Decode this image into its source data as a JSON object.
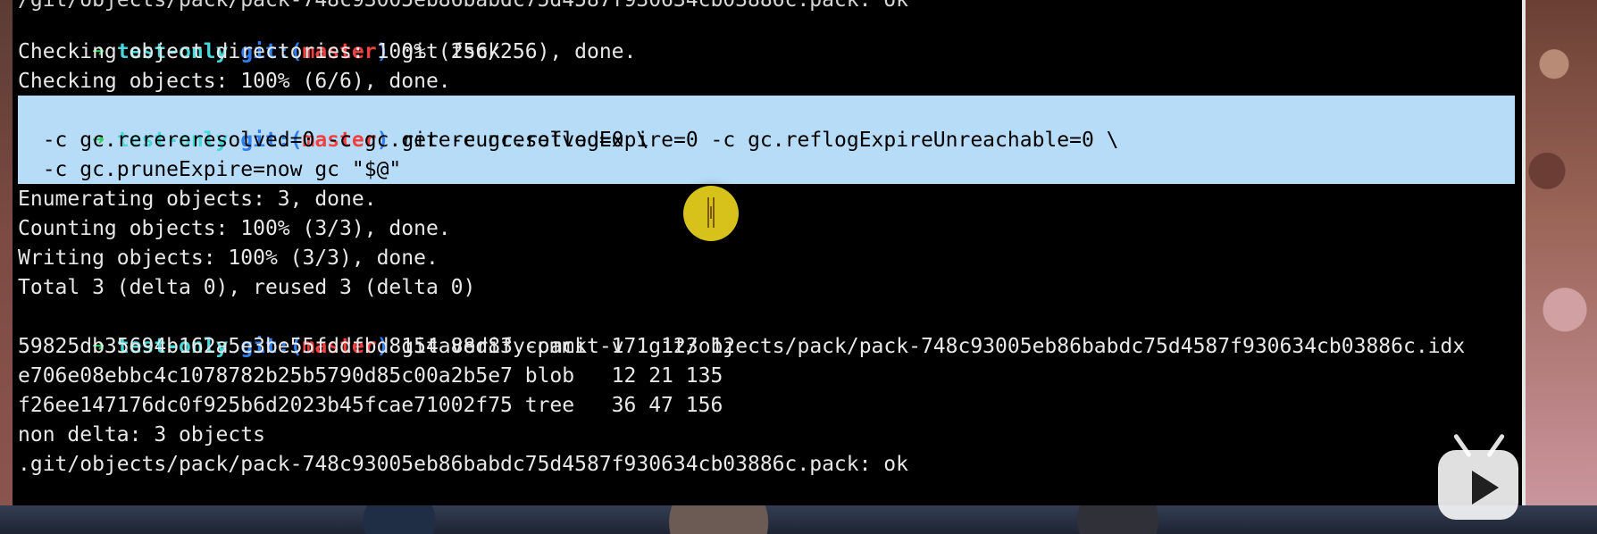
{
  "terminal": {
    "clipped_top": "/git/objects/pack/pack-748c93005eb86babdc75d4587f930634cb03886c.pack: ok",
    "prompt": {
      "arrow": "➜",
      "directory": "test-only",
      "git_label": "git:",
      "open_paren": "(",
      "branch": "master",
      "close_paren": ")"
    },
    "command_1": "git fsck",
    "output_1": [
      "Checking object directories: 100% (256/256), done.",
      "Checking objects: 100% (6/6), done."
    ],
    "command_2_lines": [
      "git -c gc.reflogExpire=0 -c gc.reflogExpireUnreachable=0 \\",
      "  -c gc.rerereresolved=0 -c gc.rerereunresolved=0 \\",
      "  -c gc.pruneExpire=now gc \"$@\""
    ],
    "output_2": [
      "Enumerating objects: 3, done.",
      "Counting objects: 100% (3/3), done.",
      "Writing objects: 100% (3/3), done.",
      "Total 3 (delta 0), reused 3 (delta 0)"
    ],
    "command_3": "git verify-pack -v .git/objects/pack/pack-748c93005eb86babdc75d4587f930634cb03886c.idx",
    "verify_rows": [
      "59825db35694b162a5e3be55fddfbd8154a88d83 commit 171 123 12",
      "e706e08ebbc4c1078782b25b5790d85c00a2b5e7 blob   12 21 135",
      "f26ee147176dc0f925b6d2023b45fcae71002f75 tree   36 47 156"
    ],
    "verify_summary": [
      "non delta: 3 objects",
      ".git/objects/pack/pack-748c93005eb86babdc75d4587f930634cb03886c.pack: ok"
    ]
  },
  "overlay": {
    "mouse_icon": "text-cursor-icon",
    "player_icon": "play-icon",
    "highlight_color": "#d6c21b",
    "selection_color": "#b7dcf8"
  }
}
